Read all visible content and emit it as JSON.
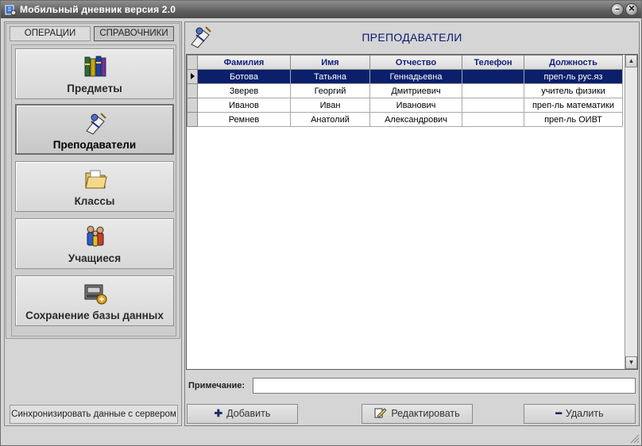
{
  "window": {
    "title": "Мобильный дневник версия 2.0"
  },
  "left": {
    "tabs": [
      "ОПЕРАЦИИ",
      "СПРАВОЧНИКИ"
    ],
    "nav": [
      {
        "label": "Предметы",
        "icon": "books-icon"
      },
      {
        "label": "Преподаватели",
        "icon": "teacher-icon"
      },
      {
        "label": "Классы",
        "icon": "folder-icon"
      },
      {
        "label": "Учащиеся",
        "icon": "students-icon"
      },
      {
        "label": "Сохранение базы данных",
        "icon": "save-database-icon"
      }
    ],
    "sync_label": "Синхронизировать данные с сервером"
  },
  "main": {
    "title": "ПРЕПОДАВАТЕЛИ",
    "columns": [
      "Фамилия",
      "Имя",
      "Отчество",
      "Телефон",
      "Должность"
    ],
    "rows": [
      [
        "Ботова",
        "Татьяна",
        "Геннадьевна",
        "",
        "преп-ль рус.яз"
      ],
      [
        "Зверев",
        "Георгий",
        "Дмитриевич",
        "",
        "учитель физики"
      ],
      [
        "Иванов",
        "Иван",
        "Иванович",
        "",
        "преп-ль математики"
      ],
      [
        "Ремнев",
        "Анатолий",
        "Александрович",
        "",
        "преп-ль ОИВТ"
      ]
    ],
    "note_label": "Примечание:",
    "note_value": "",
    "buttons": {
      "add": "Добавить",
      "edit": "Редактировать",
      "delete": "Удалить"
    }
  },
  "colors": {
    "selection": "#0b1f6b",
    "header_text": "#0f1f7a"
  }
}
